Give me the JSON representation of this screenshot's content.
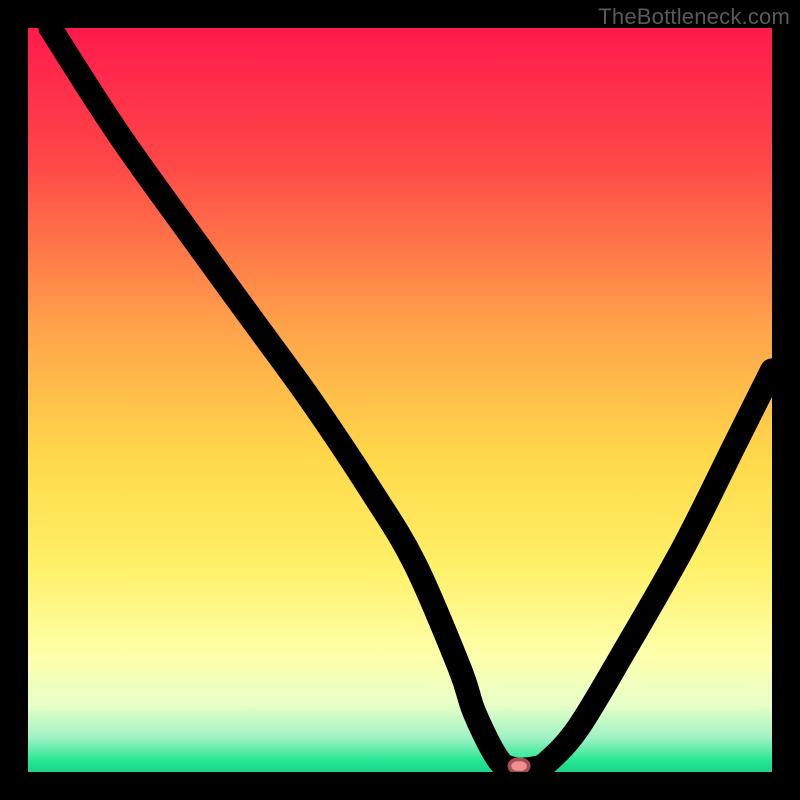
{
  "watermark": "TheBottleneck.com",
  "chart_data": {
    "type": "line",
    "title": "",
    "xlabel": "",
    "ylabel": "",
    "xlim": [
      0,
      100
    ],
    "ylim": [
      0,
      100
    ],
    "series": [
      {
        "name": "bottleneck-curve",
        "x": [
          3,
          12,
          22,
          30,
          38,
          46,
          52,
          58,
          60,
          63,
          65,
          68,
          70,
          74,
          80,
          88,
          95,
          100
        ],
        "y": [
          100,
          86,
          72,
          61,
          50,
          38,
          28,
          14,
          8,
          2,
          0.5,
          0.5,
          1.5,
          6,
          16,
          30,
          44,
          54
        ]
      }
    ],
    "marker": {
      "x": 66,
      "y": 0.8
    },
    "gradient_stops": [
      {
        "offset": 0,
        "color": "#ff1a4d"
      },
      {
        "offset": 0.18,
        "color": "#ff4747"
      },
      {
        "offset": 0.4,
        "color": "#ffa24a"
      },
      {
        "offset": 0.58,
        "color": "#ffd94a"
      },
      {
        "offset": 0.72,
        "color": "#fff066"
      },
      {
        "offset": 0.84,
        "color": "#feffa9"
      },
      {
        "offset": 0.91,
        "color": "#e8ffc8"
      },
      {
        "offset": 0.955,
        "color": "#9cf2c2"
      },
      {
        "offset": 0.985,
        "color": "#24e793"
      },
      {
        "offset": 1.0,
        "color": "#1ad38a"
      }
    ]
  }
}
